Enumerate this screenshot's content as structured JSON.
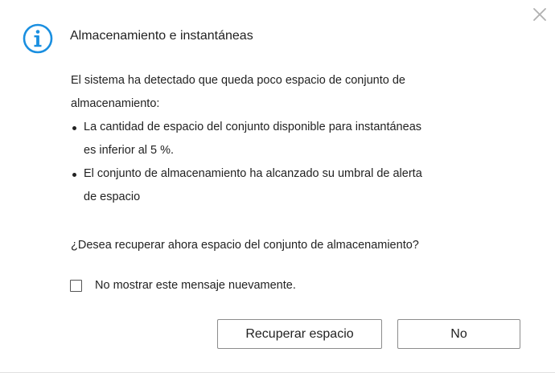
{
  "dialog": {
    "title": "Almacenamiento e instantáneas",
    "icon": "info-icon",
    "close_icon": "close-icon",
    "accent_color": "#1a8fe0",
    "intro_line1": "El sistema ha detectado que queda poco espacio de conjunto de",
    "intro_line2": "almacenamiento:",
    "bullets": [
      {
        "line1": "La cantidad de espacio del conjunto disponible para instantáneas",
        "line2": "es inferior al 5 %."
      },
      {
        "line1": "El conjunto de almacenamiento ha alcanzado su umbral de alerta",
        "line2": "de espacio"
      }
    ],
    "question": "¿Desea recuperar ahora espacio del conjunto de almacenamiento?",
    "checkbox_label": "No mostrar este mensaje nuevamente.",
    "checkbox_checked": false,
    "buttons": {
      "recover_label": "Recuperar espacio",
      "no_label": "No"
    }
  }
}
